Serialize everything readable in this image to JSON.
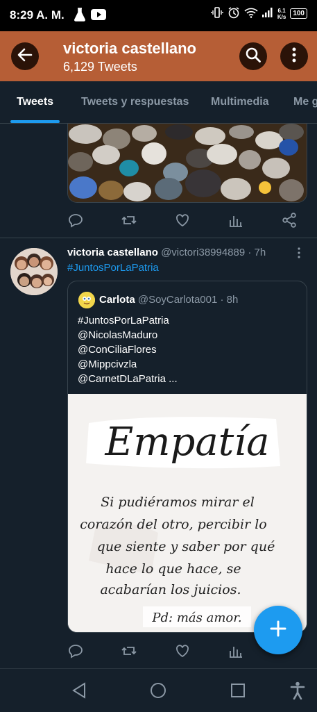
{
  "status_bar": {
    "time": "8:29 A. M.",
    "net_speed_value": "6.1",
    "net_speed_unit": "K/s",
    "battery": "100"
  },
  "header": {
    "name": "victoria castellano",
    "tweet_count": "6,129 Tweets"
  },
  "tabs": [
    {
      "label": "Tweets",
      "active": true
    },
    {
      "label": "Tweets y respuestas",
      "active": false
    },
    {
      "label": "Multimedia",
      "active": false
    },
    {
      "label": "Me g",
      "active": false
    }
  ],
  "tweet2": {
    "author_name": "victoria castellano",
    "handle": "@victori38994889",
    "time": "· 7h",
    "text": "#JuntosPorLaPatria"
  },
  "quoted_tweet": {
    "author_name": "Carlota",
    "handle": "@SoyCarlota001",
    "time": "· 8h",
    "lines": [
      "#JuntosPorLaPatria",
      "@NicolasMaduro",
      "@ConCiliaFlores",
      "@Mippcivzla",
      "@CarnetDLaPatria ..."
    ],
    "image": {
      "title": "Empatía",
      "body": [
        "Si pudiéramos mirar el",
        "corazón del otro, percibir lo",
        "que siente y saber por qué",
        "hace lo que hace, se",
        "acabarían los juicios."
      ],
      "signature": "Pd: más amor."
    }
  },
  "colors": {
    "background": "#15202b",
    "header": "#b65e36",
    "accent": "#1d9bf0",
    "muted_text": "#8b98a5"
  },
  "icons": [
    "back-arrow-icon",
    "search-icon",
    "more-vertical-icon",
    "reply-icon",
    "retweet-icon",
    "like-icon",
    "analytics-icon",
    "share-icon",
    "compose-plus-icon",
    "nav-back-icon",
    "nav-home-icon",
    "nav-recents-icon",
    "accessibility-icon"
  ]
}
